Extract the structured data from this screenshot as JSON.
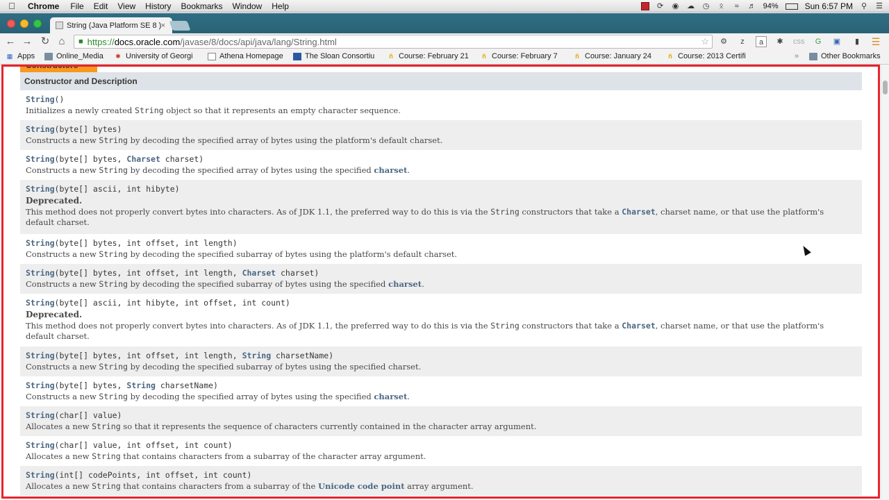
{
  "menubar": {
    "items": [
      "Chrome",
      "File",
      "Edit",
      "View",
      "History",
      "Bookmarks",
      "Window",
      "Help"
    ],
    "battery": "94%",
    "clock": "Sun 6:57 PM"
  },
  "tab": {
    "title": "String (Java Platform SE 8 )"
  },
  "omnibox": {
    "scheme": "https://",
    "host": "docs.oracle.com",
    "path": "/javase/8/docs/api/java/lang/String.html"
  },
  "bookmarks": {
    "apps": "Apps",
    "items": [
      "Online_Media",
      "University of Georgi",
      "Athena Homepage",
      "The Sloan Consortiu",
      "Course: February 21",
      "Course: February 7",
      "Course: January 24",
      "Course: 2013 Certifi"
    ],
    "other": "Other Bookmarks"
  },
  "section": {
    "tab_label": "Constructors",
    "header": "Constructor and Description"
  },
  "constructors": [
    {
      "name": "String",
      "sig": "()",
      "desc": "Initializes a newly created <code>String</code> object so that it represents an empty character sequence."
    },
    {
      "name": "String",
      "sig": "(byte[] bytes)",
      "desc": "Constructs a new <code>String</code> by decoding the specified array of bytes using the platform's default charset."
    },
    {
      "name": "String",
      "sig": "(byte[] bytes, <type>Charset</type> charset)",
      "desc": "Constructs a new <code>String</code> by decoding the specified array of bytes using the specified <lnk>charset</lnk>."
    },
    {
      "name": "String",
      "sig": "(byte[] ascii, int hibyte)",
      "deprecated": "Deprecated.",
      "desc": "This method does not properly convert bytes into characters. As of JDK 1.1, the preferred way to do this is via the <code>String</code> constructors that take a <lnkm>Charset</lnkm>, charset name, or that use the platform's default charset."
    },
    {
      "name": "String",
      "sig": "(byte[] bytes, int offset, int length)",
      "desc": "Constructs a new <code>String</code> by decoding the specified subarray of bytes using the platform's default charset."
    },
    {
      "name": "String",
      "sig": "(byte[] bytes, int offset, int length, <type>Charset</type> charset)",
      "desc": "Constructs a new <code>String</code> by decoding the specified subarray of bytes using the specified <lnk>charset</lnk>."
    },
    {
      "name": "String",
      "sig": "(byte[] ascii, int hibyte, int offset, int count)",
      "deprecated": "Deprecated.",
      "desc": "This method does not properly convert bytes into characters. As of JDK 1.1, the preferred way to do this is via the <code>String</code> constructors that take a <lnkm>Charset</lnkm>, charset name, or that use the platform's default charset."
    },
    {
      "name": "String",
      "sig": "(byte[] bytes, int offset, int length, <type>String</type> charsetName)",
      "desc": "Constructs a new <code>String</code> by decoding the specified subarray of bytes using the specified charset."
    },
    {
      "name": "String",
      "sig": "(byte[] bytes, <type>String</type> charsetName)",
      "desc": "Constructs a new <code>String</code> by decoding the specified array of bytes using the specified <lnk>charset</lnk>."
    },
    {
      "name": "String",
      "sig": "(char[] value)",
      "desc": "Allocates a new <code>String</code> so that it represents the sequence of characters currently contained in the character array argument."
    },
    {
      "name": "String",
      "sig": "(char[] value, int offset, int count)",
      "desc": "Allocates a new <code>String</code> that contains characters from a subarray of the character array argument."
    },
    {
      "name": "String",
      "sig": "(int[] codePoints, int offset, int count)",
      "desc": "Allocates a new <code>String</code> that contains characters from a subarray of the <lnk>Unicode code point</lnk> array argument."
    }
  ]
}
